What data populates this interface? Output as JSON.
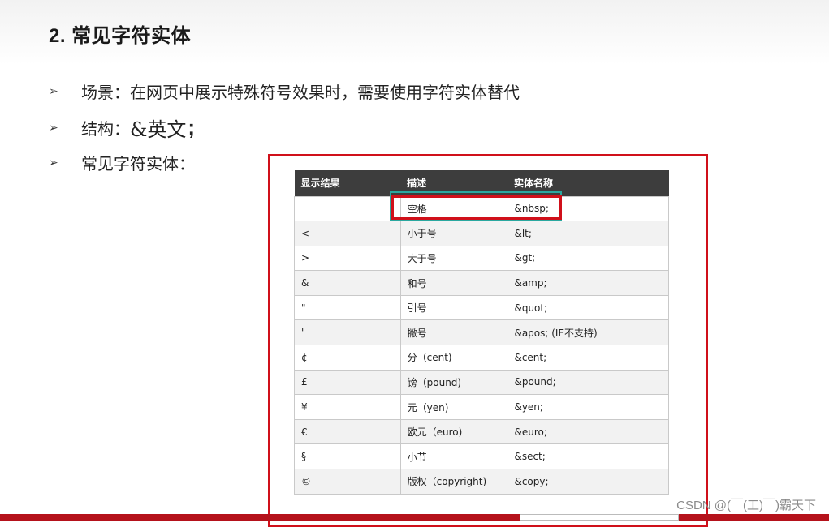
{
  "slide": {
    "title": "2. 常见字符实体",
    "bullets": {
      "scene": "场景：在网页中展示特殊符号效果时，需要使用字符实体替代",
      "structure_label": "结构：",
      "structure_value": "&英文",
      "structure_semicolon": ";",
      "common": "常见字符实体："
    }
  },
  "table": {
    "headers": [
      "显示结果",
      "描述",
      "实体名称"
    ],
    "rows": [
      [
        "",
        "空格",
        "&nbsp;"
      ],
      [
        "<",
        "小于号",
        "&lt;"
      ],
      [
        ">",
        "大于号",
        "&gt;"
      ],
      [
        "&",
        "和号",
        "&amp;"
      ],
      [
        "\"",
        "引号",
        "&quot;"
      ],
      [
        "'",
        "撇号",
        "&apos; (IE不支持)"
      ],
      [
        "¢",
        "分（cent)",
        "&cent;"
      ],
      [
        "£",
        "镑（pound)",
        "&pound;"
      ],
      [
        "¥",
        "元（yen)",
        "&yen;"
      ],
      [
        "€",
        "欧元（euro)",
        "&euro;"
      ],
      [
        "§",
        "小节",
        "&sect;"
      ],
      [
        "©",
        "版权（copyright)",
        "&copy;"
      ]
    ]
  },
  "watermark": "CSDN @(￣(工)￣)霸天下",
  "colors": {
    "highlight_red": "#d0101a",
    "highlight_teal": "#2aa8a0",
    "table_header_bg": "#3d3d3d",
    "footer_bar": "#b5121b"
  }
}
